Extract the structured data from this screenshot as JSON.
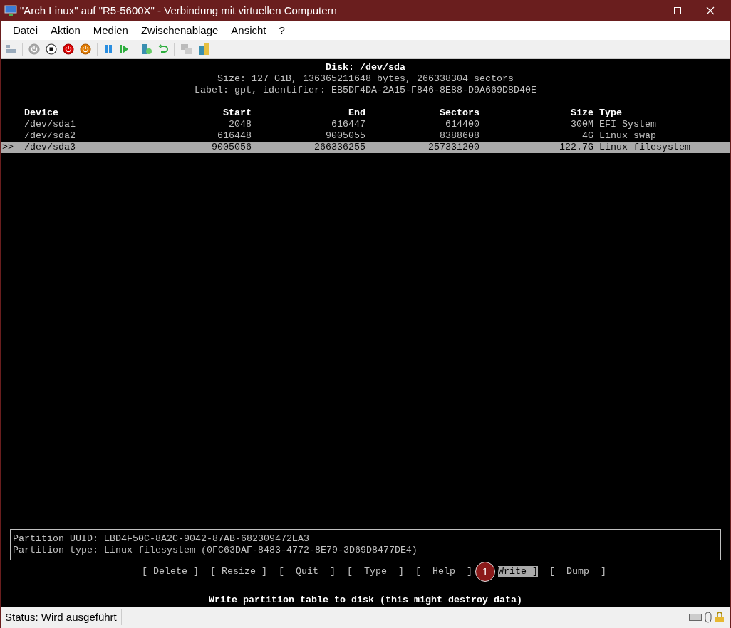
{
  "window": {
    "title": "\"Arch Linux\" auf \"R5-5600X\" - Verbindung mit virtuellen Computern"
  },
  "menu": [
    "Datei",
    "Aktion",
    "Medien",
    "Zwischenablage",
    "Ansicht",
    "?"
  ],
  "disk": {
    "title": "Disk: /dev/sda",
    "size": "Size: 127 GiB, 136365211648 bytes, 266338304 sectors",
    "label": "Label: gpt, identifier: EB5DF4DA-2A15-F846-8E88-D9A669D8D40E"
  },
  "table": {
    "columns": [
      "Device",
      "Start",
      "End",
      "Sectors",
      "Size",
      "Type"
    ],
    "rows": [
      {
        "marker": "",
        "cells": [
          "/dev/sda1",
          "2048",
          "616447",
          "614400",
          "300M",
          "EFI System"
        ],
        "selected": false
      },
      {
        "marker": "",
        "cells": [
          "/dev/sda2",
          "616448",
          "9005055",
          "8388608",
          "4G",
          "Linux swap"
        ],
        "selected": false
      },
      {
        "marker": ">>",
        "cells": [
          "/dev/sda3",
          "9005056",
          "266336255",
          "257331200",
          "122.7G",
          "Linux filesystem"
        ],
        "selected": true
      }
    ]
  },
  "info": [
    "Partition UUID: EBD4F50C-8A2C-9042-87AB-682309472EA3",
    "Partition type: Linux filesystem (0FC63DAF-8483-4772-8E79-3D69D8477DE4)"
  ],
  "actions": [
    {
      "label": "[ Delete ]",
      "selected": false
    },
    {
      "label": "[ Resize ]",
      "selected": false
    },
    {
      "label": "[  Quit  ]",
      "selected": false
    },
    {
      "label": "[  Type  ]",
      "selected": false
    },
    {
      "label": "[  Help  ]",
      "selected": false
    },
    {
      "label": "Write ]",
      "selected": true,
      "badge": "1"
    },
    {
      "label": "[  Dump  ]",
      "selected": false
    }
  ],
  "hint": "Write partition table to disk (this might destroy data)",
  "status_bar": {
    "text": "Status: Wird ausgeführt"
  }
}
